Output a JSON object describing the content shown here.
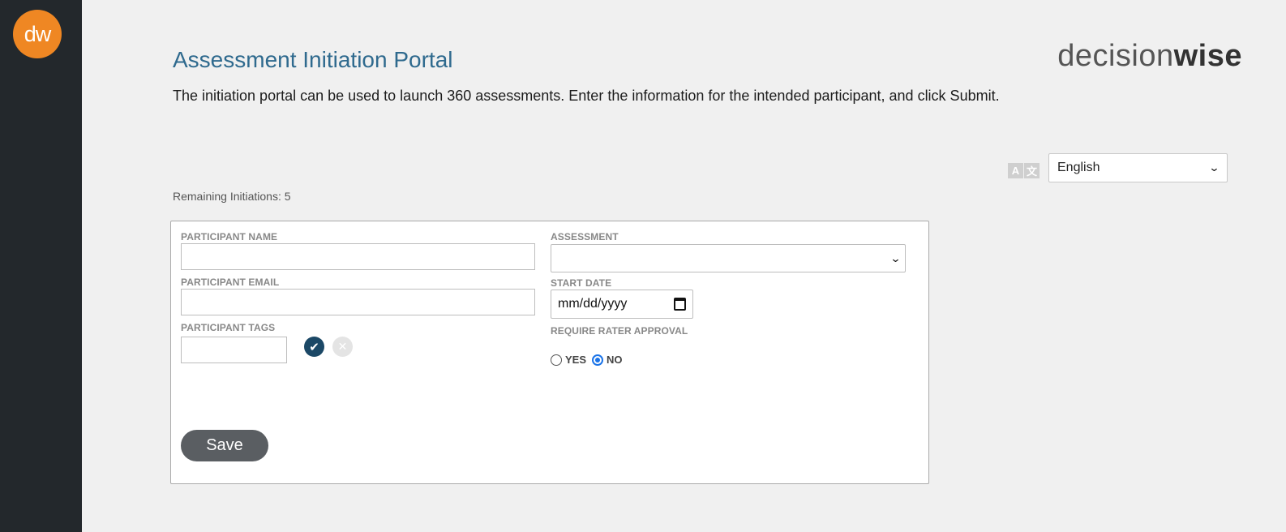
{
  "logo": {
    "text_d": "d",
    "text_w": "w"
  },
  "brand": {
    "light": "decision",
    "bold": "wise"
  },
  "header": {
    "title": "Assessment Initiation Portal",
    "description": "The initiation portal can be used to launch 360 assessments. Enter the information for the intended participant, and click Submit."
  },
  "language": {
    "icon_a": "A",
    "icon_b": "文",
    "selected": "English"
  },
  "remaining": "Remaining Initiations: 5",
  "form": {
    "participant_name_label": "PARTICIPANT NAME",
    "participant_name_value": "",
    "participant_email_label": "PARTICIPANT EMAIL",
    "participant_email_value": "",
    "participant_tags_label": "PARTICIPANT TAGS",
    "participant_tags_value": "",
    "assessment_label": "ASSESSMENT",
    "assessment_value": "",
    "start_date_label": "START DATE",
    "start_date_placeholder": "mm/dd/yyyy",
    "rater_approval_label": "REQUIRE RATER APPROVAL",
    "yes_label": "YES",
    "no_label": "NO",
    "rater_approval_selected": "NO",
    "save_label": "Save"
  },
  "colors": {
    "sidebar": "#23282c",
    "logo_orange": "#ef8723",
    "title_blue": "#2f6a8e",
    "confirm_navy": "#1b4866",
    "save_gray": "#5a5e62"
  }
}
